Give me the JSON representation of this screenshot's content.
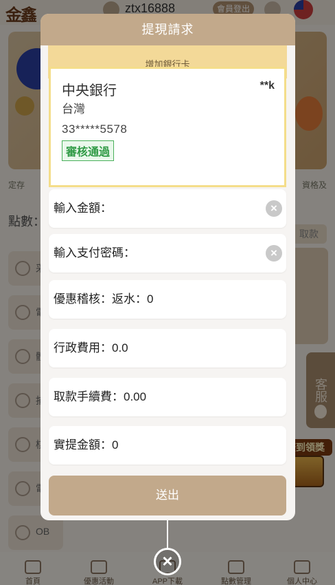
{
  "background": {
    "logo_text": "金鑫",
    "username": "ztx16888",
    "logout_label": "會員登出",
    "marquee_left": "定存",
    "marquee_right": "資格及",
    "points_label": "點數：",
    "withdraw_mini": "取款",
    "side_items": [
      {
        "label": "采",
        "icon": "chip-icon"
      },
      {
        "label": "電",
        "icon": "monitor-icon"
      },
      {
        "label": "體",
        "icon": "ball-icon"
      },
      {
        "label": "捕",
        "icon": "fish-icon"
      },
      {
        "label": "棋",
        "icon": "cards-icon"
      },
      {
        "label": "電",
        "icon": "gamepad-icon"
      },
      {
        "label": "OB",
        "icon": "ob-icon"
      }
    ],
    "customer_service": "客服",
    "signin_reward": "簽到領獎",
    "bottom_nav": [
      {
        "label": "首頁",
        "icon": "home-icon"
      },
      {
        "label": "優惠活動",
        "icon": "gift-icon"
      },
      {
        "label": "APP下載",
        "icon": "download-icon"
      },
      {
        "label": "點數管理",
        "icon": "wallet-icon"
      },
      {
        "label": "個人中心",
        "icon": "user-icon"
      }
    ]
  },
  "modal": {
    "title": "提現請求",
    "add_card_label": "增加銀行卡",
    "bank_card": {
      "bank_name": "中央銀行",
      "holder": "**k",
      "region": "台灣",
      "account": "33*****5578",
      "status": "審核通過"
    },
    "fields": [
      {
        "label": "輸入金額：",
        "clearable": true
      },
      {
        "label": "輸入支付密碼：",
        "clearable": true
      },
      {
        "label": "優惠稽核：返水：0",
        "clearable": false
      },
      {
        "label": "行政費用：0.0",
        "clearable": false
      },
      {
        "label": "取款手續費：0.00",
        "clearable": false
      },
      {
        "label": "實提金額：0",
        "clearable": false
      }
    ],
    "clear_glyph": "×",
    "submit_label": "送出",
    "close_glyph": "×"
  },
  "colors": {
    "accent": "#c2a98b",
    "card_border": "#f4dd8a",
    "status_green": "#2f9a45"
  }
}
